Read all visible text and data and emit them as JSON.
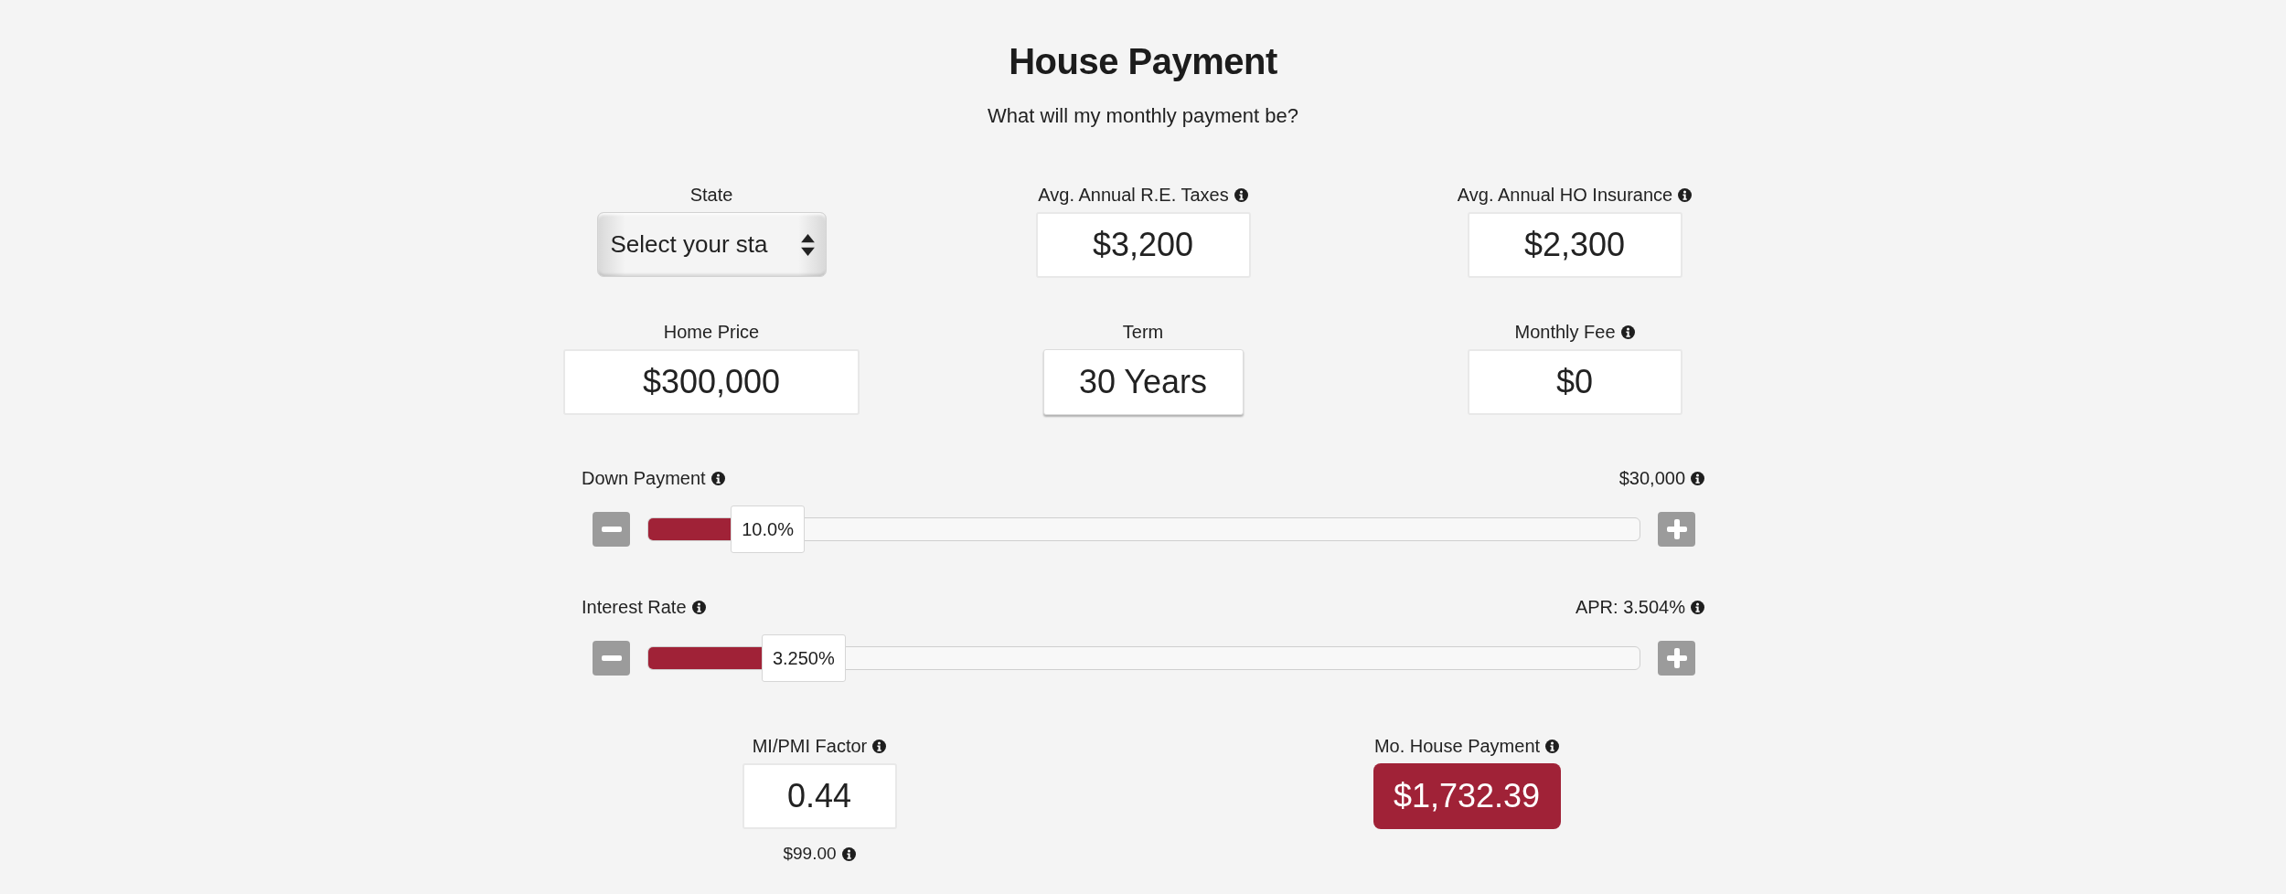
{
  "header": {
    "title": "House Payment",
    "subtitle": "What will my monthly payment be?"
  },
  "fields": [
    {
      "kind": "select",
      "label": "State",
      "info": false,
      "value": "Select your sta"
    },
    {
      "kind": "input",
      "label": "Avg. Annual R.E. Taxes",
      "info": true,
      "value": "$3,200"
    },
    {
      "kind": "input",
      "label": "Avg. Annual HO Insurance",
      "info": true,
      "value": "$2,300"
    },
    {
      "kind": "input",
      "label": "Home Price",
      "info": false,
      "value": "$300,000"
    },
    {
      "kind": "picker",
      "label": "Term",
      "info": false,
      "value": "30 Years"
    },
    {
      "kind": "input",
      "label": "Monthly Fee",
      "info": true,
      "value": "$0"
    }
  ],
  "sliders": [
    {
      "label": "Down Payment",
      "info": true,
      "reading": "$30,000",
      "reading_info": true,
      "handle": "10.0%",
      "level": 0.084
    },
    {
      "label": "Interest Rate",
      "info": true,
      "reading": "APR: 3.504%",
      "reading_info": true,
      "handle": "3.250%",
      "level": 0.115
    }
  ],
  "results": [
    {
      "kind": "input",
      "label": "MI/PMI Factor",
      "info": true,
      "value": "0.44",
      "note": "$99.00",
      "note_info": true
    },
    {
      "kind": "total",
      "label": "Mo. House Payment",
      "info": true,
      "value": "$1,732.39"
    }
  ]
}
